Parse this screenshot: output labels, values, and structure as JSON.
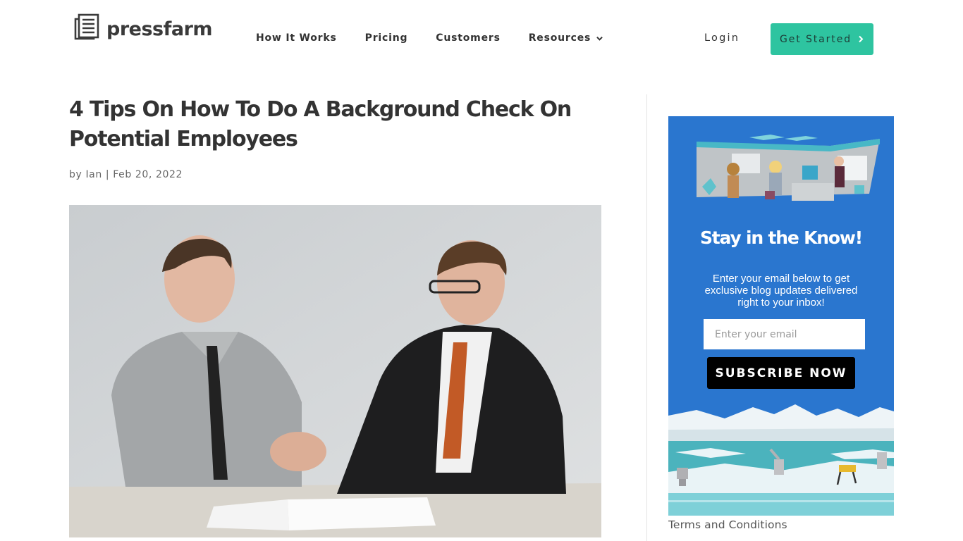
{
  "brand": {
    "name": "pressfarm",
    "accent_color": "#2ec4a0",
    "widget_color": "#2a76cf"
  },
  "nav": {
    "items": [
      {
        "label": "How It Works"
      },
      {
        "label": "Pricing"
      },
      {
        "label": "Customers"
      },
      {
        "label": "Resources",
        "has_dropdown": true
      }
    ],
    "login_label": "Login",
    "cta_label": "Get Started"
  },
  "article": {
    "title": "4 Tips On How To Do A Background Check On Potential Employees",
    "author_prefix": "by",
    "author": "Ian",
    "separator": "|",
    "date": "Feb 20, 2022",
    "hero_image_alt": "Two men in business attire shaking hands across a desk with documents"
  },
  "sidebar": {
    "widget": {
      "title": "Stay in the Know!",
      "description": "Enter your email below to get exclusive blog updates delivered right to your inbox!",
      "email_placeholder": "Enter your email",
      "email_value": "",
      "subscribe_label": "SUBSCRIBE NOW"
    },
    "terms_link": "Terms and Conditions"
  }
}
